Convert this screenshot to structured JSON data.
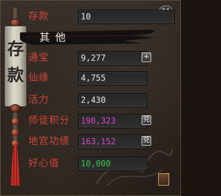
{
  "scroll": {
    "chars": [
      "存",
      "款"
    ]
  },
  "close": {
    "label": "X"
  },
  "deposit": {
    "label": "存款",
    "value": "10"
  },
  "tab": {
    "label": "其他"
  },
  "rows": [
    {
      "label": "通宝",
      "value": "9,277",
      "button": "+",
      "value_color": "#e6e6e6"
    },
    {
      "label": "仙缘",
      "value": "4,755",
      "value_color": "#e6e6e6"
    },
    {
      "label": "活力",
      "value": "2,430",
      "value_color": "#e6e6e6"
    },
    {
      "label": "师徒积分",
      "value": "198,323",
      "button": "兑",
      "value_color": "#d548c8"
    },
    {
      "label": "地宫功绩",
      "value": "163,152",
      "button": "兑",
      "value_color": "#d548c8"
    },
    {
      "label": "好心值",
      "value": "10,000",
      "value_color": "#3fc24a"
    }
  ],
  "colors": {
    "label": "#d2473a",
    "panel": "#2a221d",
    "field": "#2a2a2a"
  },
  "icons": {
    "close": "close-icon",
    "add": "plus-icon",
    "exchange": "exchange-icon"
  }
}
